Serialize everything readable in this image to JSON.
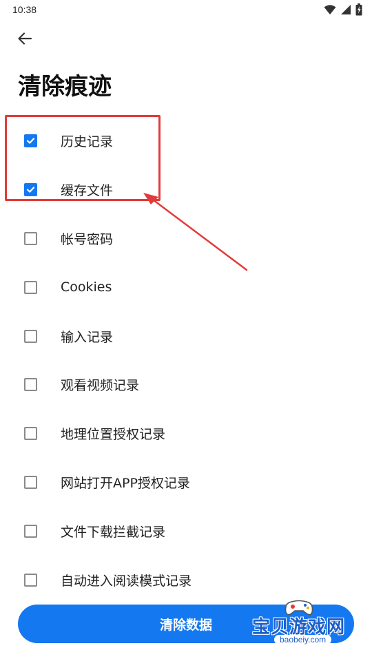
{
  "status_bar": {
    "time": "10:38",
    "icons": [
      "wifi-icon",
      "signal-icon",
      "battery-icon"
    ]
  },
  "header": {
    "back_icon": "arrow-left-icon",
    "title": "清除痕迹"
  },
  "options": [
    {
      "label": "历史记录",
      "checked": true
    },
    {
      "label": "缓存文件",
      "checked": true
    },
    {
      "label": "帐号密码",
      "checked": false
    },
    {
      "label": "Cookies",
      "checked": false
    },
    {
      "label": "输入记录",
      "checked": false
    },
    {
      "label": "观看视频记录",
      "checked": false
    },
    {
      "label": "地理位置授权记录",
      "checked": false
    },
    {
      "label": "网站打开APP授权记录",
      "checked": false
    },
    {
      "label": "文件下载拦截记录",
      "checked": false
    },
    {
      "label": "自动进入阅读模式记录",
      "checked": false
    }
  ],
  "primary_action": {
    "label": "清除数据"
  },
  "watermark": {
    "text": "宝贝游戏网",
    "url": "baobeiy.com"
  },
  "colors": {
    "accent": "#1478f0",
    "annotation": "#e23a3a"
  }
}
